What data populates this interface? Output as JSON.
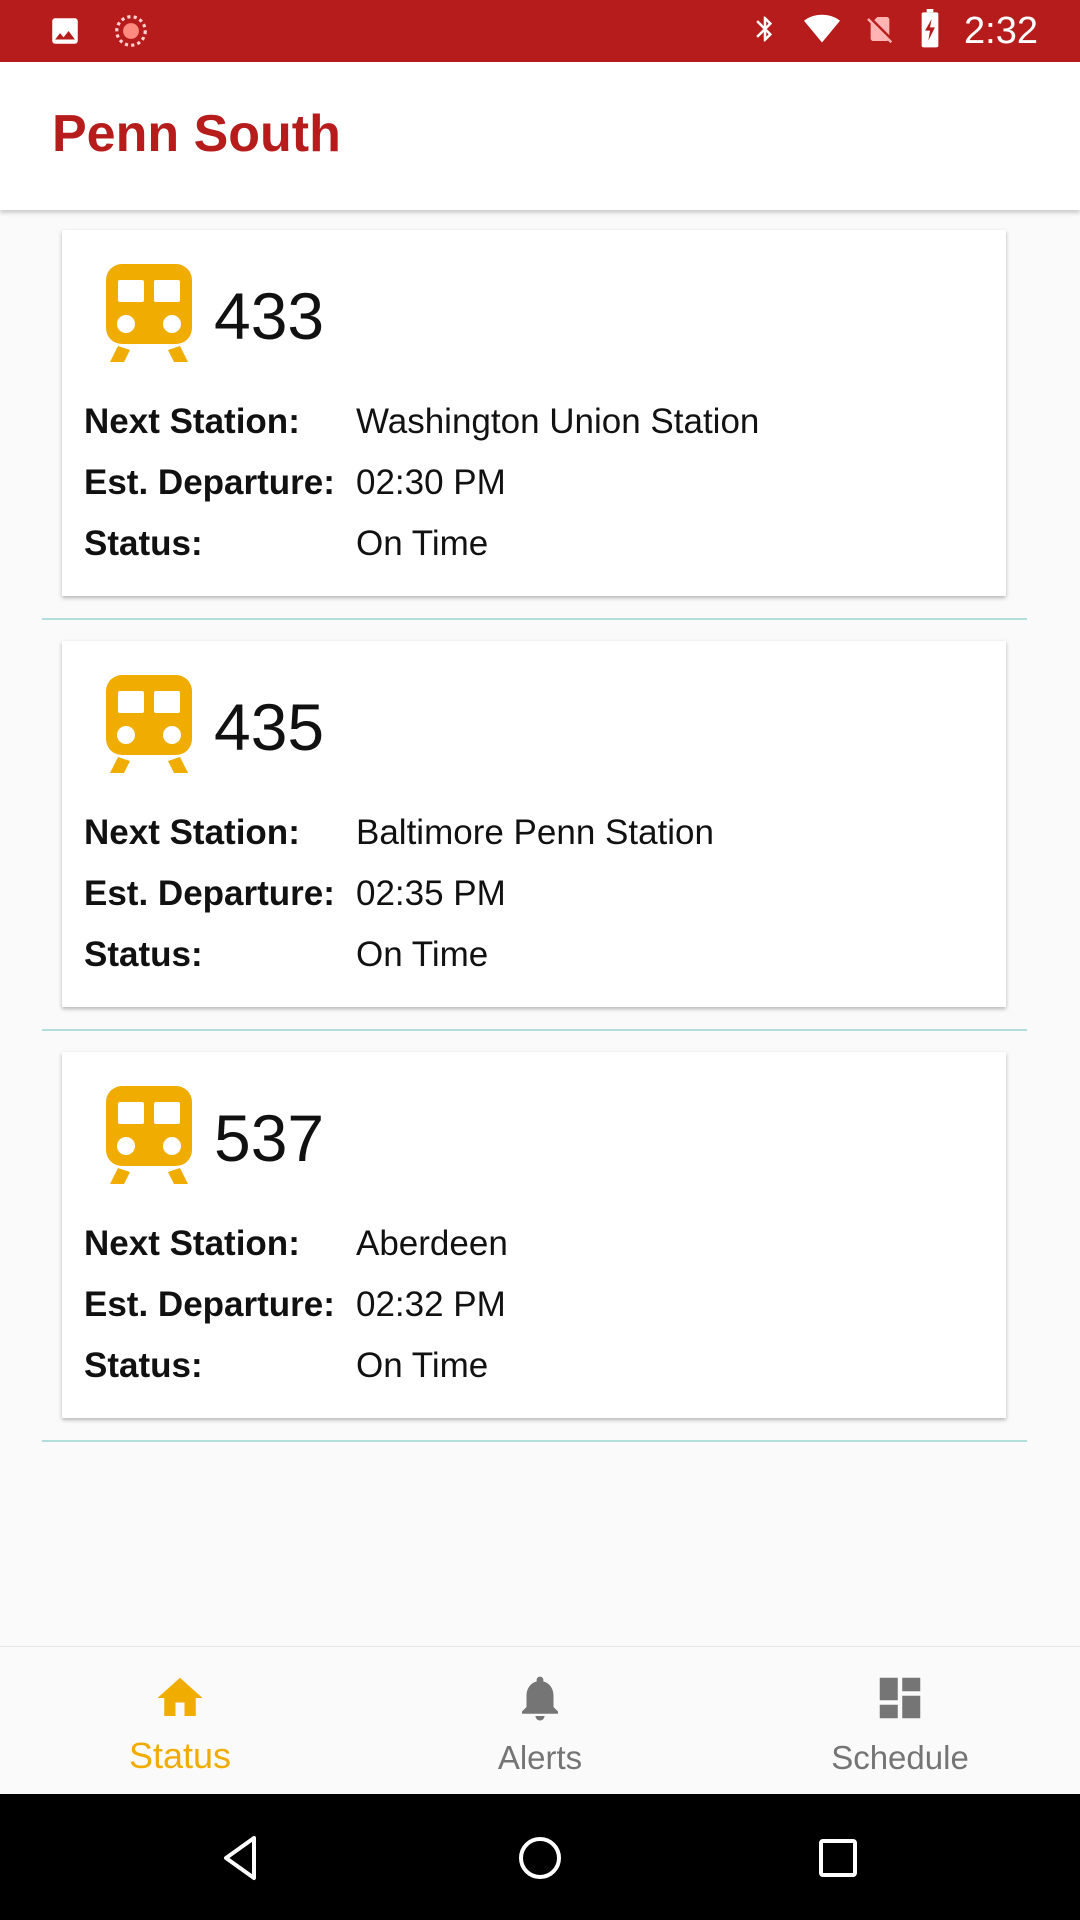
{
  "status_bar": {
    "time": "2:32",
    "left_icons": [
      "image-icon",
      "sync-indicator-icon"
    ],
    "right_icons": [
      "bluetooth-icon",
      "wifi-icon",
      "no-sim-icon",
      "battery-charging-icon"
    ],
    "color": "#b71c1c"
  },
  "app_bar": {
    "title": "Penn South",
    "title_color": "#b71c1c"
  },
  "trains": [
    {
      "number": "433",
      "next_station_label": "Next Station:",
      "next_station": "Washington Union Station",
      "departure_label": "Est. Departure:",
      "departure": "02:30 PM",
      "status_label": "Status:",
      "status": "On Time"
    },
    {
      "number": "435",
      "next_station_label": "Next Station:",
      "next_station": "Baltimore Penn Station",
      "departure_label": "Est. Departure:",
      "departure": "02:35 PM",
      "status_label": "Status:",
      "status": "On Time"
    },
    {
      "number": "537",
      "next_station_label": "Next Station:",
      "next_station": "Aberdeen",
      "departure_label": "Est. Departure:",
      "departure": "02:32 PM",
      "status_label": "Status:",
      "status": "On Time"
    }
  ],
  "bottom_nav": {
    "items": [
      {
        "label": "Status",
        "icon": "home-icon",
        "active": true
      },
      {
        "label": "Alerts",
        "icon": "bell-icon",
        "active": false
      },
      {
        "label": "Schedule",
        "icon": "dashboard-icon",
        "active": false
      }
    ],
    "active_color": "#f0ad00",
    "inactive_color": "#757575"
  },
  "system_nav": {
    "buttons": [
      "back-icon",
      "home-circle-icon",
      "recents-icon"
    ]
  },
  "colors": {
    "train_icon": "#f0ad00",
    "divider": "#b2dfdb"
  }
}
